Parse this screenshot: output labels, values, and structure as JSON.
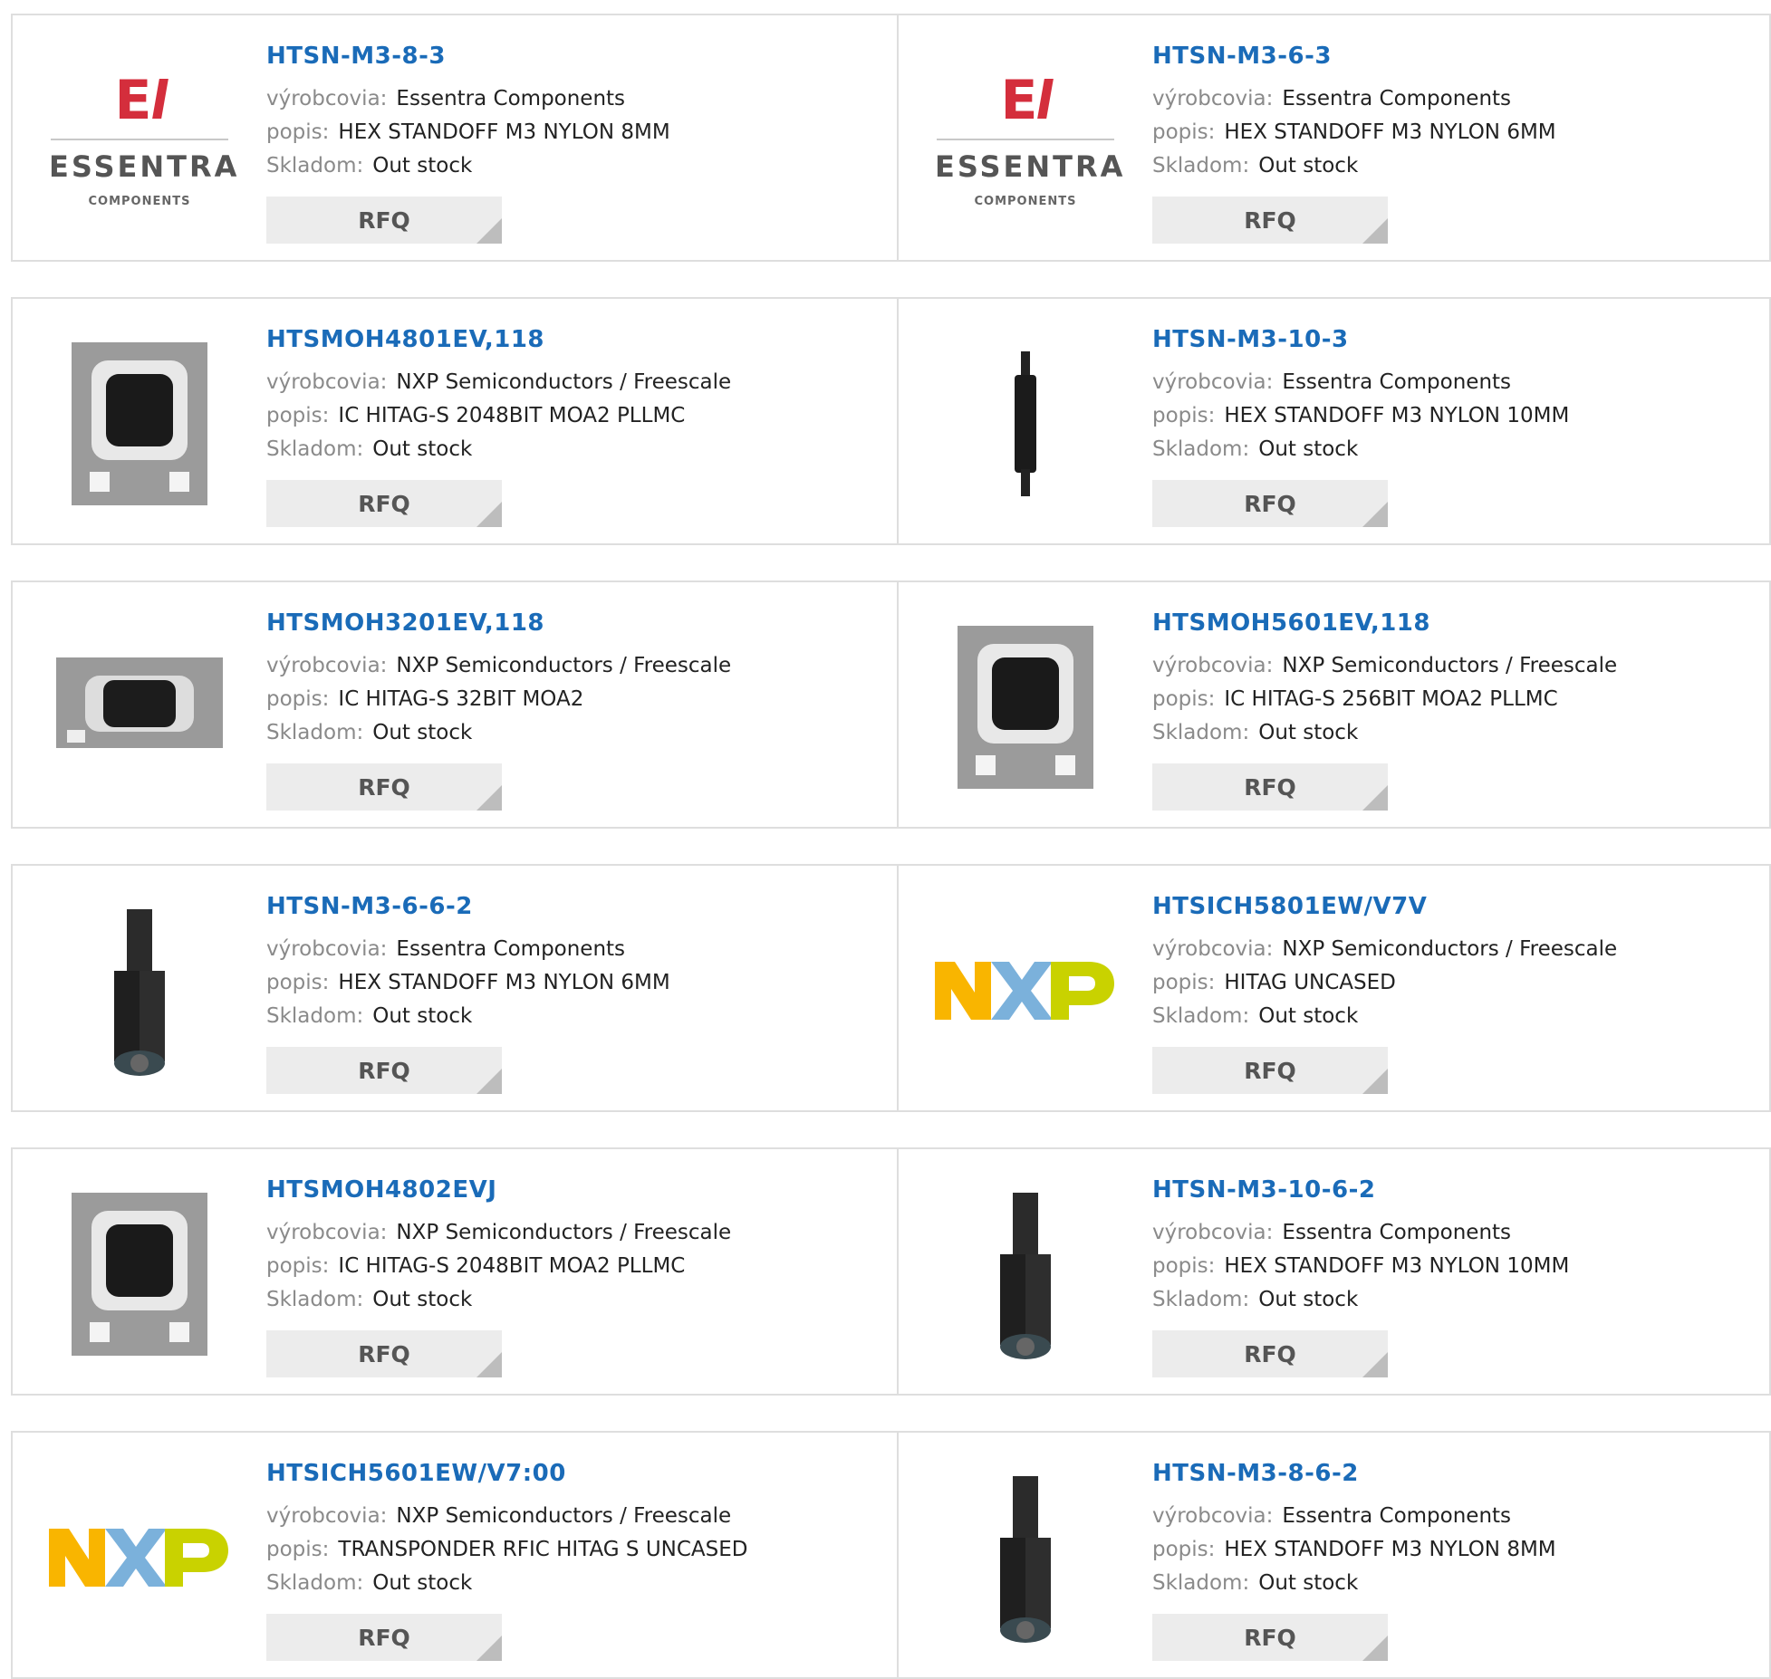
{
  "labels": {
    "manufacturer": "výrobcovia:",
    "description": "popis:",
    "stock": "Skladom:",
    "rfq": "RFQ"
  },
  "brand": {
    "essentra_word": "ESSENTRA",
    "essentra_sub": "COMPONENTS"
  },
  "products": [
    {
      "name": "HTSN-M3-8-3",
      "manufacturer": "Essentra Components",
      "description": "HEX STANDOFF M3 NYLON 8MM",
      "stock": "Out stock",
      "thumb": "essentra-logo"
    },
    {
      "name": "HTSN-M3-6-3",
      "manufacturer": "Essentra Components",
      "description": "HEX STANDOFF M3 NYLON 6MM",
      "stock": "Out stock",
      "thumb": "essentra-logo"
    },
    {
      "name": "HTSMOH4801EV,118",
      "manufacturer": "NXP Semiconductors / Freescale",
      "description": "IC HITAG-S 2048BIT MOA2 PLLMC",
      "stock": "Out stock",
      "thumb": "chip-module"
    },
    {
      "name": "HTSN-M3-10-3",
      "manufacturer": "Essentra Components",
      "description": "HEX STANDOFF M3 NYLON 10MM",
      "stock": "Out stock",
      "thumb": "thin-standoff"
    },
    {
      "name": "HTSMOH3201EV,118",
      "manufacturer": "NXP Semiconductors / Freescale",
      "description": "IC HITAG-S 32BIT MOA2",
      "stock": "Out stock",
      "thumb": "chip-module-wide"
    },
    {
      "name": "HTSMOH5601EV,118",
      "manufacturer": "NXP Semiconductors / Freescale",
      "description": "IC HITAG-S 256BIT MOA2 PLLMC",
      "stock": "Out stock",
      "thumb": "chip-module"
    },
    {
      "name": "HTSN-M3-6-6-2",
      "manufacturer": "Essentra Components",
      "description": "HEX STANDOFF M3 NYLON 6MM",
      "stock": "Out stock",
      "thumb": "hex-standoff"
    },
    {
      "name": "HTSICH5801EW/V7V",
      "manufacturer": "NXP Semiconductors / Freescale",
      "description": "HITAG UNCASED",
      "stock": "Out stock",
      "thumb": "nxp-logo"
    },
    {
      "name": "HTSMOH4802EVJ",
      "manufacturer": "NXP Semiconductors / Freescale",
      "description": "IC HITAG-S 2048BIT MOA2 PLLMC",
      "stock": "Out stock",
      "thumb": "chip-module"
    },
    {
      "name": "HTSN-M3-10-6-2",
      "manufacturer": "Essentra Components",
      "description": "HEX STANDOFF M3 NYLON 10MM",
      "stock": "Out stock",
      "thumb": "hex-standoff"
    },
    {
      "name": "HTSICH5601EW/V7:00",
      "manufacturer": "NXP Semiconductors / Freescale",
      "description": "TRANSPONDER RFIC HITAG S UNCASED",
      "stock": "Out stock",
      "thumb": "nxp-logo"
    },
    {
      "name": "HTSN-M3-8-6-2",
      "manufacturer": "Essentra Components",
      "description": "HEX STANDOFF M3 NYLON 8MM",
      "stock": "Out stock",
      "thumb": "hex-standoff"
    }
  ]
}
